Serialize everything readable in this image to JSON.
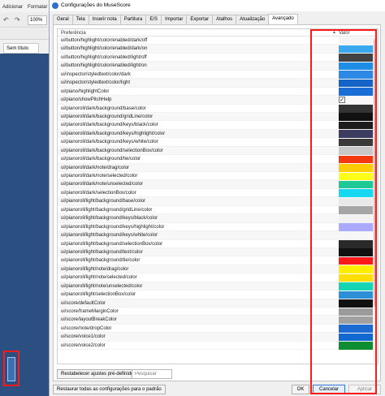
{
  "background_app": {
    "menu_items": [
      "Adicionar",
      "Formatar"
    ],
    "zoom": "100%",
    "score_tab": "Sem título"
  },
  "dialog": {
    "title": "Configurações do MuseScore",
    "tabs": [
      {
        "label": "Geral",
        "active": false
      },
      {
        "label": "Tela",
        "active": false
      },
      {
        "label": "Inserir nota",
        "active": false
      },
      {
        "label": "Partitura",
        "active": false
      },
      {
        "label": "E/S",
        "active": false
      },
      {
        "label": "Importar",
        "active": false
      },
      {
        "label": "Exportar",
        "active": false
      },
      {
        "label": "Atalhos",
        "active": false
      },
      {
        "label": "Atualização",
        "active": false
      },
      {
        "label": "Avançado",
        "active": true
      }
    ],
    "columns": {
      "preference": "Preferência",
      "value": "Valor"
    },
    "rows": [
      {
        "key": "ui/button/highlight/color/enabled/dark/off",
        "color": "#f4f4f4"
      },
      {
        "key": "ui/button/highlight/color/enabled/dark/on",
        "color": "#3aa8ef"
      },
      {
        "key": "ui/button/highlight/color/enabled/light/off",
        "color": "#424242"
      },
      {
        "key": "ui/button/highlight/color/enabled/light/on",
        "color": "#1f8fe6"
      },
      {
        "key": "ui/inspector/styledtext/color/dark",
        "color": "#2e88e5"
      },
      {
        "key": "ui/inspector/styledtext/color/light",
        "color": "#1663c8"
      },
      {
        "key": "ui/piano/highlightColor",
        "color": "#1a6dd4"
      },
      {
        "key": "ui/piano/showPitchHelp",
        "check": true
      },
      {
        "key": "ui/pianoroll/dark/background/base/color",
        "color": "#333333"
      },
      {
        "key": "ui/pianoroll/dark/background/gridLine/color",
        "color": "#111111"
      },
      {
        "key": "ui/pianoroll/dark/background/keys/black/color",
        "color": "#1c1c1c"
      },
      {
        "key": "ui/pianoroll/dark/background/keys/highlight/color",
        "color": "#3c3c60"
      },
      {
        "key": "ui/pianoroll/dark/background/keys/white/color",
        "color": "#3a3a3a"
      },
      {
        "key": "ui/pianoroll/dark/background/selectionBox/color",
        "color": "#c8c8c8"
      },
      {
        "key": "ui/pianoroll/dark/background/tie/color",
        "color": "#f2380e"
      },
      {
        "key": "ui/pianoroll/dark/note/drag/color",
        "color": "#ffcc00"
      },
      {
        "key": "ui/pianoroll/dark/note/selected/color",
        "color": "#ffff1a"
      },
      {
        "key": "ui/pianoroll/dark/note/unselected/color",
        "color": "#1ec996"
      },
      {
        "key": "ui/pianoroll/dark/selectionBox/color",
        "color": "#16d8f0"
      },
      {
        "key": "ui/pianoroll/light/background/base/color",
        "color": "#e9e9e9"
      },
      {
        "key": "ui/pianoroll/light/background/gridLine/color",
        "color": "#a6a6a6"
      },
      {
        "key": "ui/pianoroll/light/background/keys/black/color",
        "color": "#f2f2f2"
      },
      {
        "key": "ui/pianoroll/light/background/keys/highlight/color",
        "color": "#aaaaff"
      },
      {
        "key": "ui/pianoroll/light/background/keys/white/color",
        "color": "#f7f7f7"
      },
      {
        "key": "ui/pianoroll/light/background/selectionBox/color",
        "color": "#2a2a2a"
      },
      {
        "key": "ui/pianoroll/light/background/text/color",
        "color": "#111111"
      },
      {
        "key": "ui/pianoroll/light/background/tie/color",
        "color": "#ff1a1a"
      },
      {
        "key": "ui/pianoroll/light/note/drag/color",
        "color": "#ffee00"
      },
      {
        "key": "ui/pianoroll/light/note/selected/color",
        "color": "#ffdd00"
      },
      {
        "key": "ui/pianoroll/light/note/unselected/color",
        "color": "#16d4b4"
      },
      {
        "key": "ui/pianoroll/light/selectionBox/color",
        "color": "#2d8fd6"
      },
      {
        "key": "ui/score/defaultColor",
        "color": "#111111"
      },
      {
        "key": "ui/score/frameMarginColor",
        "color": "#9b9b9b"
      },
      {
        "key": "ui/score/layoutBreakColor",
        "color": "#a0a0a0"
      },
      {
        "key": "ui/score/note/dropColor",
        "color": "#1c6ad2"
      },
      {
        "key": "ui/score/voice1/color",
        "color": "#1068d0"
      },
      {
        "key": "ui/score/voice2/color",
        "color": "#0f8d33"
      }
    ],
    "reset_presets_label": "Restabelecer ajustes pré-definidos",
    "search_placeholder": "Pesquisar",
    "restore_all_label": "Restaurar todas as configurações para o padrão",
    "ok_label": "OK",
    "cancel_label": "Cancelar",
    "apply_label": "Aplicar"
  }
}
